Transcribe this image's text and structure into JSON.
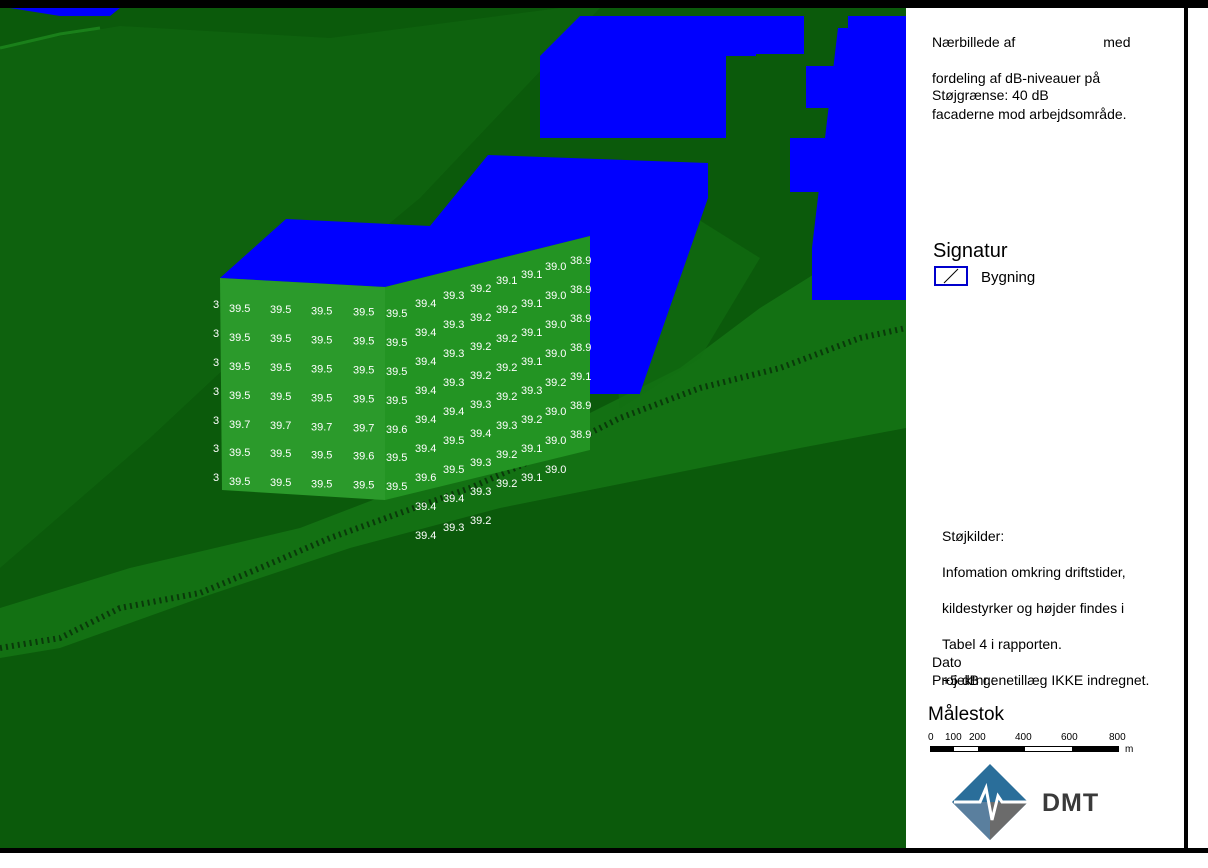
{
  "panel": {
    "description_lines": [
      "Nærbillede af",
      "med",
      "fordeling af dB-niveauer på",
      "facaderne mod arbejdsområde."
    ],
    "noise_limit": "Støjgrænse: 40 dB",
    "signature_title": "Signatur",
    "signature_item": "Bygning",
    "sources": [
      "Støjkilder:",
      "Infomation omkring driftstider,",
      "kildestyrker og højder findes i",
      "Tabel 4 i rapporten.",
      "+5 dB genetillæg IKKE indregnet."
    ],
    "date_label": "Dato",
    "project_label": "Projektnr.:",
    "scale_title": "Målestok",
    "scale_ticks": [
      "0",
      "100",
      "200",
      "400",
      "600",
      "800"
    ],
    "scale_unit": "m",
    "logo_text": "DMT"
  },
  "colors": {
    "terrain": "#0b5a0b",
    "facade": "#2b9a2b",
    "building": "#0000ff",
    "label": "#ffffff"
  },
  "facade_front": {
    "partial_column": [
      "3",
      "3",
      "3",
      "3",
      "3",
      "3",
      "3"
    ],
    "rows": [
      [
        "39.5",
        "39.5",
        "39.5",
        "39.5",
        "39.5"
      ],
      [
        "39.5",
        "39.5",
        "39.5",
        "39.5",
        "39.5"
      ],
      [
        "39.5",
        "39.5",
        "39.5",
        "39.5",
        "39.5"
      ],
      [
        "39.5",
        "39.5",
        "39.5",
        "39.5",
        "39.5"
      ],
      [
        "39.7",
        "39.7",
        "39.7",
        "39.7",
        "39.6"
      ],
      [
        "39.5",
        "39.5",
        "39.5",
        "39.6",
        "39.5"
      ],
      [
        "39.5",
        "39.5",
        "39.5",
        "39.5",
        "39.5"
      ]
    ]
  },
  "facade_side": {
    "rows": [
      [
        "39.4",
        "39.3",
        "39.2",
        "39.1",
        "39.1",
        "39.0",
        "38.9"
      ],
      [
        "39.4",
        "39.3",
        "39.2",
        "39.2",
        "39.1",
        "39.0",
        "38.9"
      ],
      [
        "39.4",
        "39.3",
        "39.2",
        "39.2",
        "39.1",
        "39.0",
        "38.9"
      ],
      [
        "39.4",
        "39.3",
        "39.2",
        "39.2",
        "39.1",
        "39.0",
        "38.9"
      ],
      [
        "39.4",
        "39.4",
        "39.3",
        "39.2",
        "39.3",
        "39.2",
        "39.1"
      ],
      [
        "39.4",
        "39.5",
        "39.4",
        "39.3",
        "39.2",
        "39.0",
        "38.9"
      ],
      [
        "39.6",
        "39.5",
        "39.3",
        "39.2",
        "39.1",
        "39.0",
        "38.9"
      ],
      [
        "39.4",
        "39.4",
        "39.3",
        "39.2",
        "39.1",
        "39.0"
      ],
      [
        "39.4",
        "39.3",
        "39.2"
      ]
    ]
  }
}
